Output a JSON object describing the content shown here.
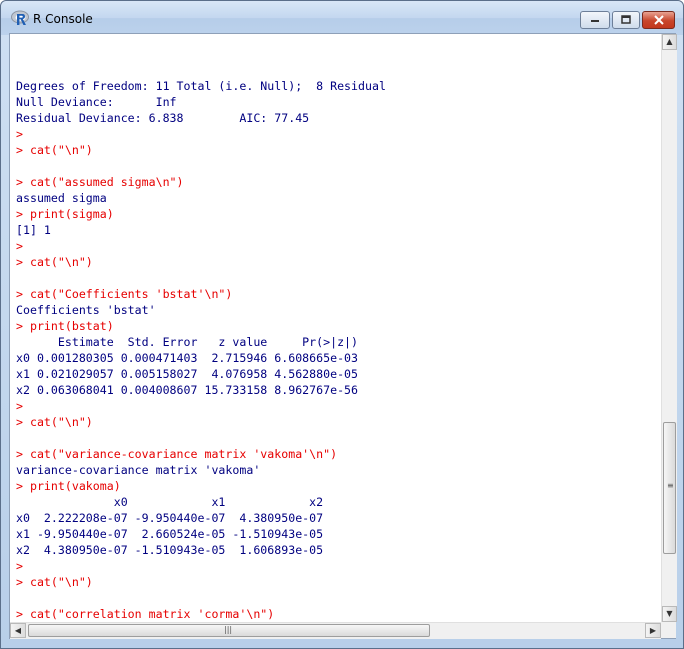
{
  "window": {
    "title": "R Console",
    "icon": "R"
  },
  "console": {
    "lines": [
      {
        "text": "",
        "type": "output"
      },
      {
        "text": "Degrees of Freedom: 11 Total (i.e. Null);  8 Residual",
        "type": "output"
      },
      {
        "text": "Null Deviance:      Inf",
        "type": "output"
      },
      {
        "text": "Residual Deviance: 6.838        AIC: 77.45",
        "type": "output"
      },
      {
        "text": ">",
        "type": "input"
      },
      {
        "text": "> cat(\"\\n\")",
        "type": "input"
      },
      {
        "text": "",
        "type": "output"
      },
      {
        "text": "> cat(\"assumed sigma\\n\")",
        "type": "input"
      },
      {
        "text": "assumed sigma",
        "type": "output"
      },
      {
        "text": "> print(sigma)",
        "type": "input"
      },
      {
        "text": "[1] 1",
        "type": "output"
      },
      {
        "text": ">",
        "type": "input"
      },
      {
        "text": "> cat(\"\\n\")",
        "type": "input"
      },
      {
        "text": "",
        "type": "output"
      },
      {
        "text": "> cat(\"Coefficients 'bstat'\\n\")",
        "type": "input"
      },
      {
        "text": "Coefficients 'bstat'",
        "type": "output"
      },
      {
        "text": "> print(bstat)",
        "type": "input"
      },
      {
        "text": "      Estimate  Std. Error   z value     Pr(>|z|)",
        "type": "output"
      },
      {
        "text": "x0 0.001280305 0.000471403  2.715946 6.608665e-03",
        "type": "output"
      },
      {
        "text": "x1 0.021029057 0.005158027  4.076958 4.562880e-05",
        "type": "output"
      },
      {
        "text": "x2 0.063068041 0.004008607 15.733158 8.962767e-56",
        "type": "output"
      },
      {
        "text": ">",
        "type": "input"
      },
      {
        "text": "> cat(\"\\n\")",
        "type": "input"
      },
      {
        "text": "",
        "type": "output"
      },
      {
        "text": "> cat(\"variance-covariance matrix 'vakoma'\\n\")",
        "type": "input"
      },
      {
        "text": "variance-covariance matrix 'vakoma'",
        "type": "output"
      },
      {
        "text": "> print(vakoma)",
        "type": "input"
      },
      {
        "text": "              x0            x1            x2",
        "type": "output"
      },
      {
        "text": "x0  2.222208e-07 -9.950440e-07  4.380950e-07",
        "type": "output"
      },
      {
        "text": "x1 -9.950440e-07  2.660524e-05 -1.510943e-05",
        "type": "output"
      },
      {
        "text": "x2  4.380950e-07 -1.510943e-05  1.606893e-05",
        "type": "output"
      },
      {
        "text": ">",
        "type": "input"
      },
      {
        "text": "> cat(\"\\n\")",
        "type": "input"
      },
      {
        "text": "",
        "type": "output"
      },
      {
        "text": "> cat(\"correlation matrix 'corma'\\n\")",
        "type": "input"
      }
    ]
  },
  "controls": {
    "minimize_icon": "minimize-icon",
    "maximize_icon": "maximize-icon",
    "close_icon": "close-icon"
  },
  "colors": {
    "input_text": "#e60000",
    "output_text": "#000080"
  }
}
